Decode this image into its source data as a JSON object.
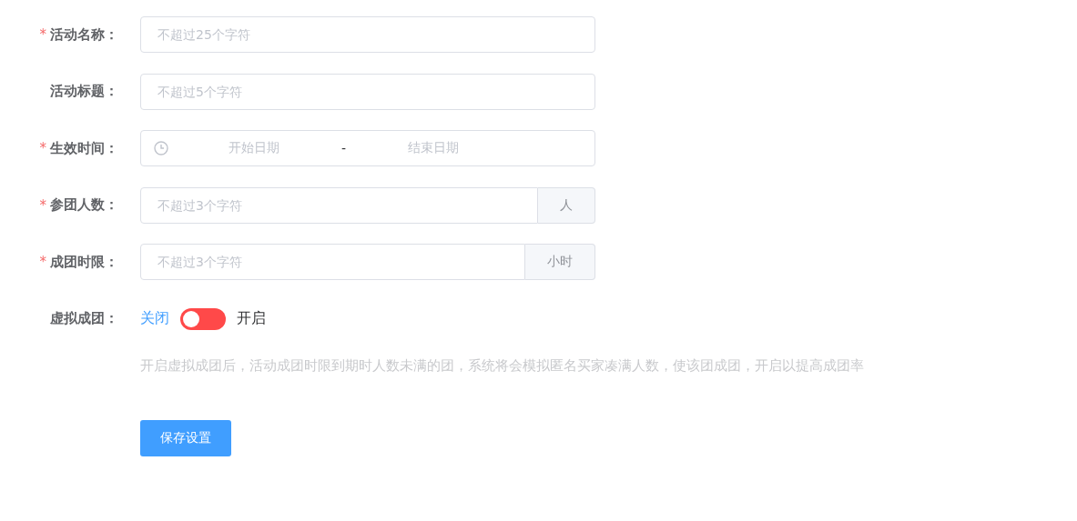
{
  "fields": [
    {
      "kind": "text",
      "required_mark": "*",
      "label": "活动名称：",
      "placeholder": "不超过25个字符"
    },
    {
      "kind": "text",
      "label": "活动标题：",
      "placeholder": "不超过5个字符"
    },
    {
      "kind": "daterange",
      "required_mark": "*",
      "label": "生效时间：",
      "start_placeholder": "开始日期",
      "separator": "-",
      "end_placeholder": "结束日期"
    },
    {
      "kind": "append",
      "required_mark": "*",
      "label": "参团人数：",
      "placeholder": "不超过3个字符",
      "append": "人"
    },
    {
      "kind": "append",
      "required_mark": "*",
      "label": "成团时限：",
      "placeholder": "不超过3个字符",
      "append": "小时"
    }
  ],
  "virtual_group": {
    "label": "虚拟成团：",
    "off_text": "关闭",
    "on_text": "开启",
    "on": false
  },
  "hint": "开启虚拟成团后，活动成团时限到期时人数未满的团，系统将会模拟匿名买家凑满人数，使该团成团，开启以提高成团率",
  "save_button": "保存设置"
}
